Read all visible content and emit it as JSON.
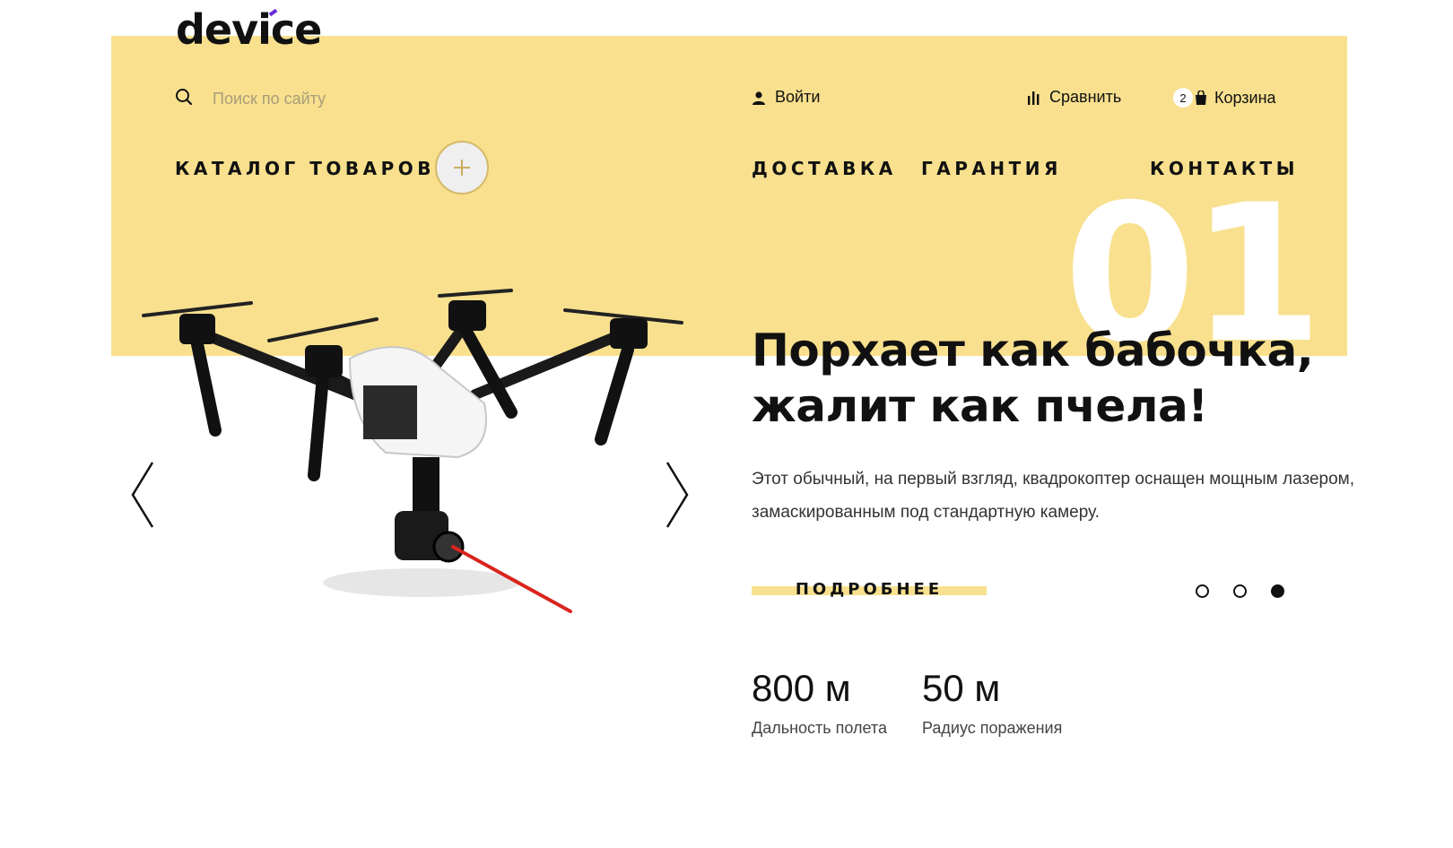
{
  "brand": {
    "logo_text": "device",
    "accent_color": "#f8e08e"
  },
  "header": {
    "search": {
      "placeholder": "Поиск по сайту",
      "value": ""
    },
    "login_label": "Войти",
    "compare_label": "Сравнить",
    "cart": {
      "count": "2",
      "label": "Корзина"
    }
  },
  "nav": {
    "catalog_label": "КАТАЛОГ ТОВАРОВ",
    "items": [
      "ДОСТАВКА",
      "ГАРАНТИЯ",
      "КОНТАКТЫ"
    ]
  },
  "slider": {
    "number": "01",
    "headline_line1": "Порхает как бабочка,",
    "headline_line2": "жалит как пчела!",
    "description": "Этот обычный, на первый взгляд, квадрокоптер оснащен мощным лазером, замаскированным под стандартную камеру.",
    "more_label": "ПОДРОБНЕЕ",
    "dot_count": 3,
    "active_dot": 3
  },
  "stats": [
    {
      "value": "800 м",
      "label": "Дальность полета"
    },
    {
      "value": "50 м",
      "label": "Радиус поражения"
    }
  ],
  "icons": {
    "search": "search-icon",
    "user": "user-icon",
    "compare": "bar-chart-icon",
    "cart": "cart-icon",
    "plus": "plus-icon",
    "prev": "chevron-left-icon",
    "next": "chevron-right-icon"
  }
}
